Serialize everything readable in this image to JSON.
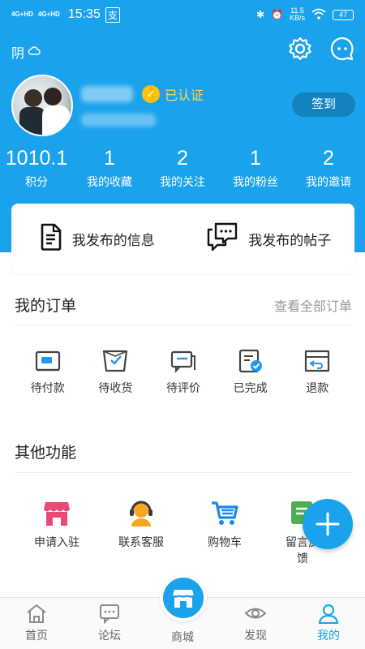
{
  "status_bar": {
    "network_1": "4G+HD",
    "network_2": "4G+HD",
    "time": "15:35",
    "speed": "11.5",
    "speed_unit": "KB/s",
    "battery": "47"
  },
  "header": {
    "weather": "阴",
    "verified_label": "已认证",
    "signin_label": "签到",
    "stats": [
      {
        "value": "1010.1",
        "label": "积分"
      },
      {
        "value": "1",
        "label": "我的收藏"
      },
      {
        "value": "2",
        "label": "我的关注"
      },
      {
        "value": "1",
        "label": "我的粉丝"
      },
      {
        "value": "2",
        "label": "我的邀请"
      }
    ]
  },
  "posts": {
    "my_info": "我发布的信息",
    "my_posts": "我发布的帖子"
  },
  "orders": {
    "title": "我的订单",
    "view_all": "查看全部订单",
    "items": [
      {
        "label": "待付款",
        "icon": "wallet-icon"
      },
      {
        "label": "待收货",
        "icon": "box-receive-icon"
      },
      {
        "label": "待评价",
        "icon": "comment-icon"
      },
      {
        "label": "已完成",
        "icon": "completed-icon"
      },
      {
        "label": "退款",
        "icon": "refund-icon"
      }
    ]
  },
  "other": {
    "title": "其他功能",
    "items": [
      {
        "label": "申请入驻",
        "icon": "store-icon"
      },
      {
        "label": "联系客服",
        "icon": "customer-service-icon"
      },
      {
        "label": "购物车",
        "icon": "cart-icon"
      },
      {
        "label": "留言反馈",
        "icon": "feedback-icon"
      }
    ]
  },
  "nav": {
    "items": [
      {
        "label": "首页",
        "icon": "home-icon"
      },
      {
        "label": "论坛",
        "icon": "forum-icon"
      },
      {
        "label": "商城",
        "icon": "shop-icon"
      },
      {
        "label": "发现",
        "icon": "discover-icon"
      },
      {
        "label": "我的",
        "icon": "profile-icon"
      }
    ],
    "active": "我的"
  },
  "colors": {
    "primary": "#1aa3ec",
    "verified": "#ffd54f",
    "signin_bg": "#1382be",
    "store": "#e84a73",
    "service": "#f5a623",
    "cart": "#1e88e5",
    "feedback": "#4caf50"
  }
}
